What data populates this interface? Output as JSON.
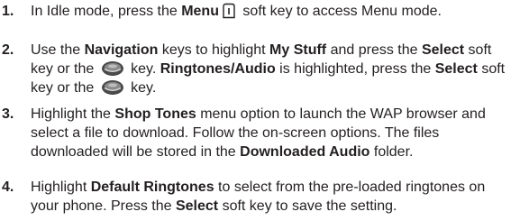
{
  "steps": [
    {
      "number": "1.",
      "lines": [
        {
          "t1": "In Idle mode, press the ",
          "b1": "Menu",
          "icon": "menu-softkey-icon",
          "t2": " soft key to access Menu mode."
        }
      ]
    },
    {
      "number": "2.",
      "lines": [
        {
          "t1": "Use the ",
          "b1": "Navigation",
          "t2": " keys to highlight ",
          "b2": "My Stuff",
          "t3": " and press the ",
          "b3": "Select",
          "t4": " soft"
        },
        {
          "t1": "key or the ",
          "icon": "select-key-icon",
          "t2": " key. ",
          "b1": "Ringtones/Audio",
          "t3": " is highlighted, press the ",
          "b2": "Select",
          "t4": " soft"
        },
        {
          "t1": "key or the ",
          "icon": "select-key-icon",
          "t2": " key."
        }
      ]
    },
    {
      "number": "3.",
      "lines": [
        {
          "t1": "Highlight the ",
          "b1": "Shop Tones",
          "t2": " menu option to launch the WAP browser and"
        },
        {
          "t1": "select a file to download. Follow the on-screen options. The files"
        },
        {
          "t1": "downloaded will be stored in the ",
          "b1": "Downloaded Audio",
          "t2": " folder."
        }
      ]
    },
    {
      "number": "4.",
      "lines": [
        {
          "t1": "Highlight ",
          "b1": "Default Ringtones",
          "t2": " to select from the pre-loaded ringtones on"
        },
        {
          "t1": "your phone. Press the ",
          "b1": "Select",
          "t2": " soft key to save the setting."
        }
      ]
    }
  ]
}
